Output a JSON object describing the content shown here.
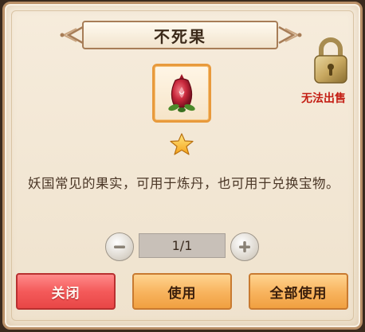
{
  "dialog": {
    "title": "不死果",
    "untradeable_label": "无法出售",
    "description": "妖国常见的果实，可用于炼丹，也可用于兑换宝物。",
    "item_icon": "pomegranate-fruit-icon",
    "rarity_icon": "gold-star-icon",
    "lock_icon": "padlock-icon"
  },
  "quantity": {
    "display": "1/1",
    "current": 1,
    "max": 1
  },
  "buttons": {
    "close_label": "关闭",
    "use_label": "使用",
    "use_all_label": "全部使用"
  },
  "colors": {
    "close_button": "#f45a5a",
    "use_button": "#f8b560",
    "untradeable_text": "#c41e14",
    "item_frame": "#e89a3c"
  }
}
